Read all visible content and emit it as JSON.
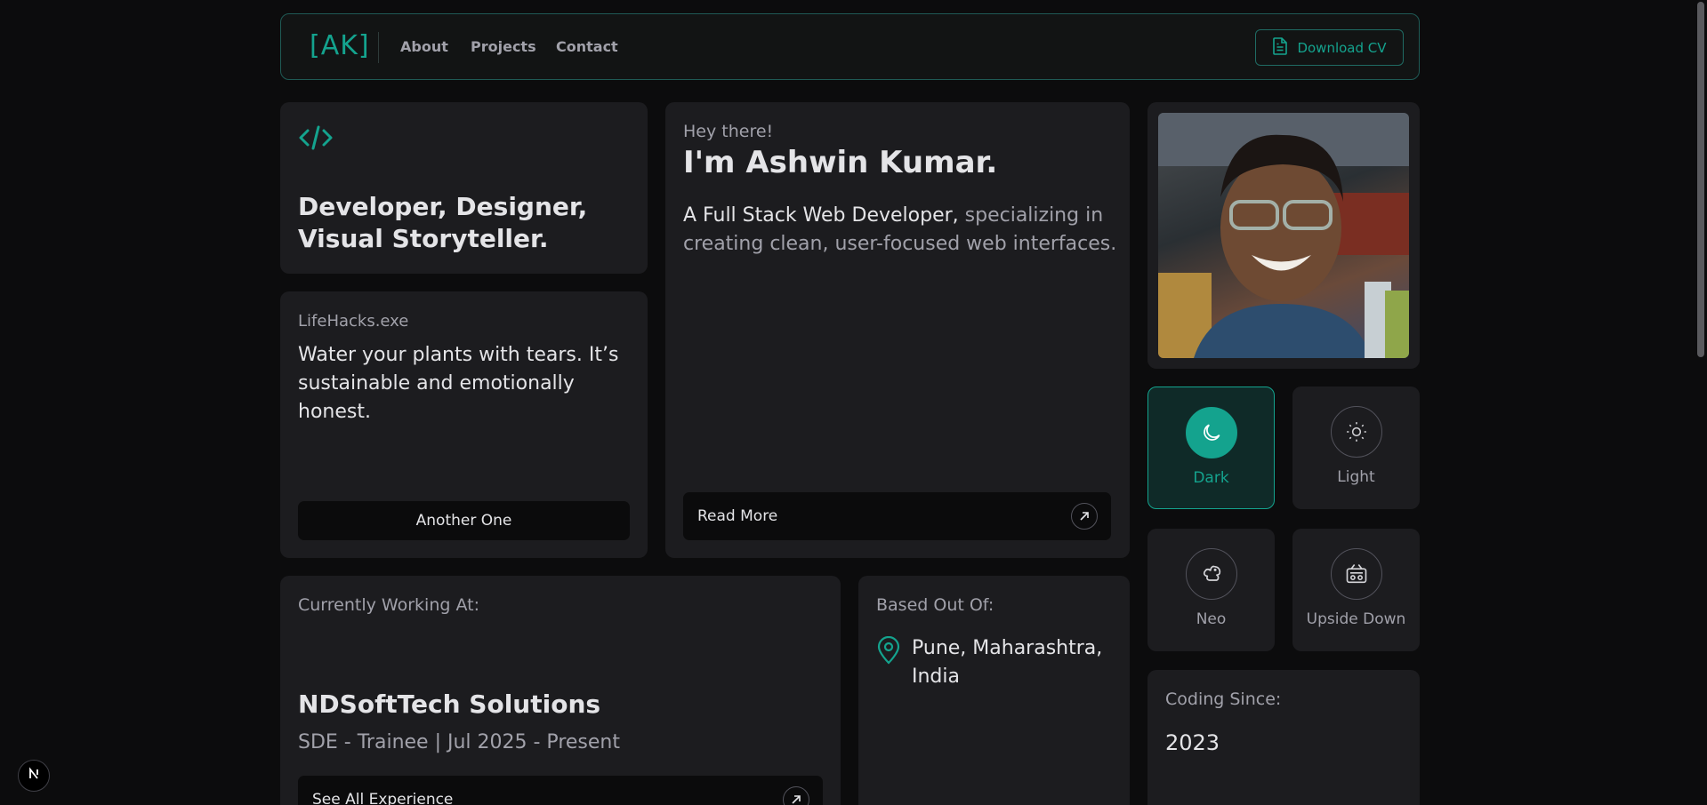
{
  "nav": {
    "logo": "[AK]",
    "links": [
      "About",
      "Projects",
      "Contact"
    ],
    "cv_label": "Download CV"
  },
  "tagline": {
    "icon": "code-icon",
    "text": "Developer, Designer, Visual Storyteller."
  },
  "intro": {
    "greeting": "Hey there!",
    "name": "I'm Ashwin Kumar.",
    "desc_strong": "A Full Stack Web Developer,",
    "desc_rest": " specializing in creating clean, user-focused web interfaces.",
    "read_more": "Read More"
  },
  "lifehack": {
    "title": "LifeHacks.exe",
    "text": "Water your plants with tears. It’s sustainable and emotionally honest.",
    "button": "Another One"
  },
  "themes": [
    {
      "label": "Dark",
      "icon": "moon-icon",
      "active": true
    },
    {
      "label": "Light",
      "icon": "sun-icon",
      "active": false
    },
    {
      "label": "Neo",
      "icon": "squirrel-icon",
      "active": false
    },
    {
      "label": "Upside Down",
      "icon": "radio-icon",
      "active": false
    }
  ],
  "work": {
    "title": "Currently Working At:",
    "company": "NDSoftTech Solutions",
    "role": "SDE - Trainee | Jul 2025 - Present",
    "button": "See All Experience"
  },
  "location": {
    "title": "Based Out Of:",
    "place": "Pune, Maharashtra, India"
  },
  "coding": {
    "title": "Coding Since:",
    "year": "2023"
  },
  "colors": {
    "accent": "#14a38e",
    "background": "#0c0c0d",
    "card": "#1c1c1f"
  }
}
